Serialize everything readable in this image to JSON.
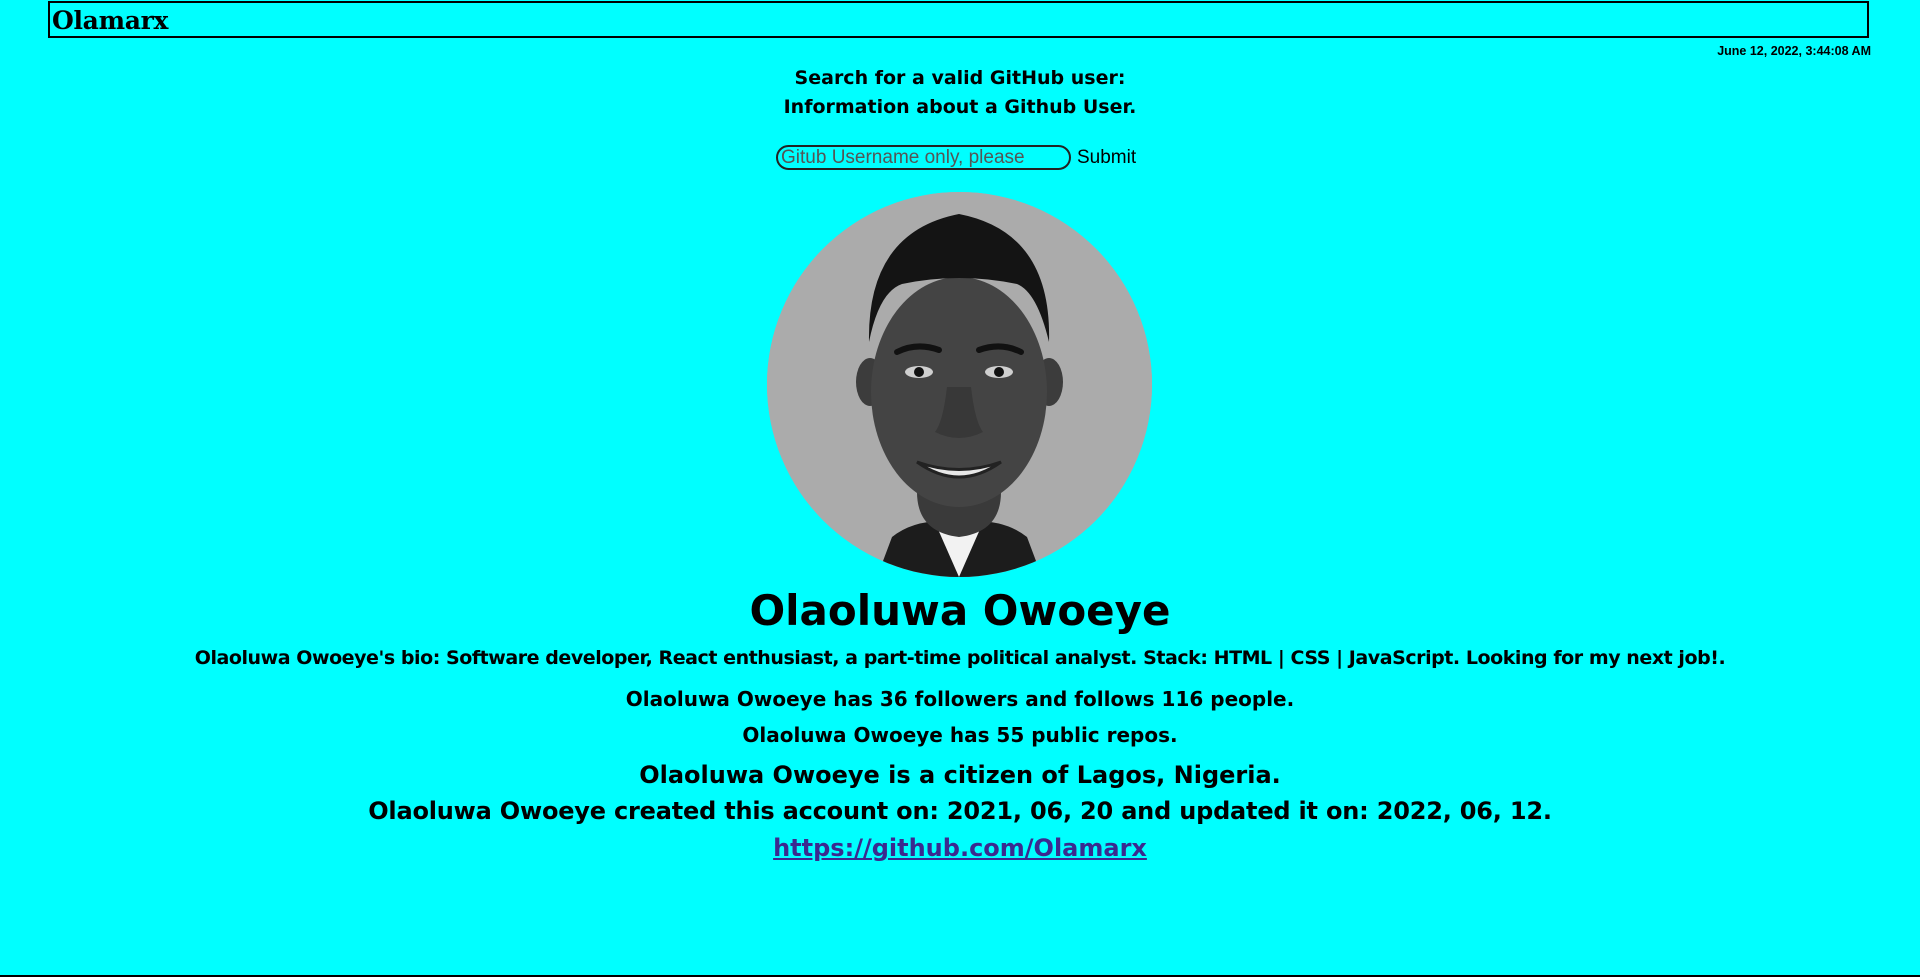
{
  "header": {
    "brand": "Olamarx",
    "timestamp": "June 12, 2022, 3:44:08 AM"
  },
  "search": {
    "prompt_line1": "Search for a valid GitHub user:",
    "prompt_line2": "Information about a Github User.",
    "placeholder": "Gitub Username only, please",
    "value": "",
    "submit_label": "Submit"
  },
  "profile": {
    "avatar_icon": "avatar-photo",
    "name": "Olaoluwa Owoeye",
    "bio": "Olaoluwa Owoeye's bio: Software developer, React enthusiast, a part-time political analyst. Stack: HTML | CSS | JavaScript. Looking for my next job!.",
    "follow_text": "Olaoluwa Owoeye has 36 followers and follows 116 people.",
    "repos_text": "Olaoluwa Owoeye has 55 public repos.",
    "location_text": "Olaoluwa Owoeye is a citizen of Lagos, Nigeria.",
    "created_text": "Olaoluwa Owoeye created this account on: 2021, 06, 20 and updated it on: 2022, 06, 12.",
    "url": "https://github.com/Olamarx"
  },
  "colors": {
    "background": "#00ffff",
    "link": "#3b2a8f",
    "avatar_bg": "#ababab"
  }
}
